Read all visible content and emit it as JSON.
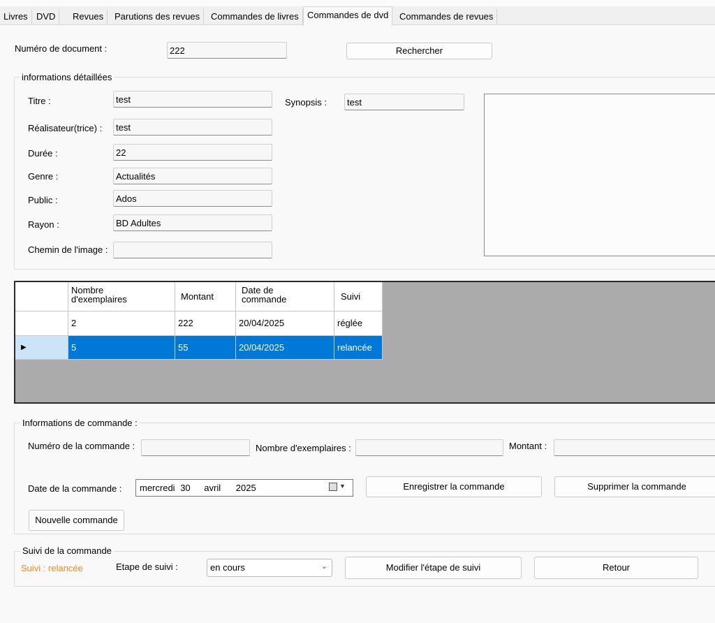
{
  "tabs": [
    "Livres",
    "DVD",
    "Revues",
    "Parutions des revues",
    "Commandes de livres",
    "Commandes de dvd",
    "Commandes de revues"
  ],
  "search": {
    "label": "Numéro de document :",
    "value": "222",
    "button": "Rechercher"
  },
  "details": {
    "group_title": "informations détaillées",
    "titre_label": "Titre :",
    "titre_value": "test",
    "realisateur_label": "Réalisateur(trice) :",
    "realisateur_value": "test",
    "duree_label": "Durée :",
    "duree_value": "22",
    "genre_label": "Genre :",
    "genre_value": "Actualités",
    "public_label": "Public :",
    "public_value": "Ados",
    "rayon_label": "Rayon :",
    "rayon_value": "BD Adultes",
    "chemin_label": "Chemin de l'image :",
    "chemin_value": "",
    "synopsis_label": "Synopsis :",
    "synopsis_value": "test"
  },
  "grid": {
    "headers": [
      "Nombre\nd'exemplaires",
      "Montant",
      "Date de\ncommande",
      "Suivi"
    ],
    "header_lines": [
      [
        "Nombre",
        "d'exemplaires"
      ],
      [
        "Montant"
      ],
      [
        "Date de",
        "commande"
      ],
      [
        "Suivi"
      ]
    ],
    "rows": [
      {
        "exemplaires": "2",
        "montant": "222",
        "date": "20/04/2025",
        "suivi": "réglée",
        "selected": false
      },
      {
        "exemplaires": "5",
        "montant": "55",
        "date": "20/04/2025",
        "suivi": "relancée",
        "selected": true
      }
    ],
    "selected_color": "#0078d7"
  },
  "commande": {
    "group_title": "Informations de commande :",
    "numero_label": "Numéro de la commande :",
    "numero_value": "",
    "nombre_label": "Nombre d'exemplaires :",
    "nombre_value": "",
    "montant_label": "Montant :",
    "montant_value": "",
    "date_label": "Date de la commande :",
    "date_weekday": "mercredi",
    "date_day": "30",
    "date_month": "avril",
    "date_year": "2025",
    "enregistrer_button": "Enregistrer la commande",
    "supprimer_button": "Supprimer la commande",
    "nouvelle_button": "Nouvelle commande"
  },
  "suivi": {
    "group_title": "Suivi de la commande",
    "status_text": "Suivi : relancée",
    "status_color": "#f08a1c",
    "etape_label": "Etape de suivi :",
    "etape_value": "en cours",
    "modifier_button": "Modifier l'étape de suivi",
    "retour_button": "Retour"
  }
}
